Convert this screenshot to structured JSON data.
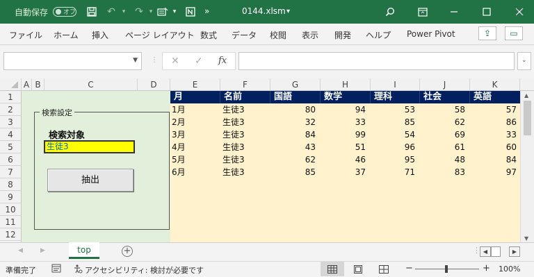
{
  "titlebar": {
    "autosave_label": "自動保存",
    "autosave_state": "オフ",
    "filename": "0144.xlsm",
    "filename_caret": "▾",
    "more": "»"
  },
  "ribbon": {
    "tabs": [
      "ファイル",
      "ホーム",
      "挿入",
      "ページ レイアウト",
      "数式",
      "データ",
      "校閲",
      "表示",
      "開発",
      "ヘルプ",
      "Power Pivot"
    ]
  },
  "formula_bar": {
    "name_box": "",
    "cancel": "✕",
    "enter": "✓",
    "fx": "fx",
    "content": ""
  },
  "grid": {
    "columns": [
      "A",
      "B",
      "C",
      "D",
      "E",
      "F",
      "G",
      "H",
      "I",
      "J",
      "K"
    ],
    "rows": [
      "1",
      "2",
      "3",
      "4",
      "5",
      "6",
      "7",
      "8",
      "9",
      "10",
      "11",
      "12"
    ],
    "table_headers": [
      "月",
      "名前",
      "国語",
      "数学",
      "理科",
      "社会",
      "英語"
    ],
    "table_rows": [
      [
        "1月",
        "生徒3",
        "80",
        "94",
        "53",
        "58",
        "57"
      ],
      [
        "2月",
        "生徒3",
        "32",
        "33",
        "85",
        "62",
        "86"
      ],
      [
        "3月",
        "生徒3",
        "84",
        "99",
        "54",
        "69",
        "33"
      ],
      [
        "4月",
        "生徒3",
        "43",
        "51",
        "96",
        "61",
        "60"
      ],
      [
        "5月",
        "生徒3",
        "62",
        "46",
        "95",
        "48",
        "84"
      ],
      [
        "6月",
        "生徒3",
        "85",
        "37",
        "71",
        "83",
        "97"
      ]
    ]
  },
  "search_panel": {
    "group_title": "検索設定",
    "target_label": "検索対象",
    "target_value": "生徒3",
    "extract_button": "抽出"
  },
  "sheets": {
    "active": "top",
    "add": "+"
  },
  "status": {
    "ready": "準備完了",
    "accessibility": "アクセシビリティ: 検討が必要です",
    "zoom_minus": "−",
    "zoom_plus": "+",
    "zoom": "100%"
  },
  "colors": {
    "excel_green": "#217346",
    "header_navy": "#002060",
    "panel_green": "#e2efda",
    "data_yellow": "#fff2cc",
    "input_yellow": "#ffff00"
  }
}
